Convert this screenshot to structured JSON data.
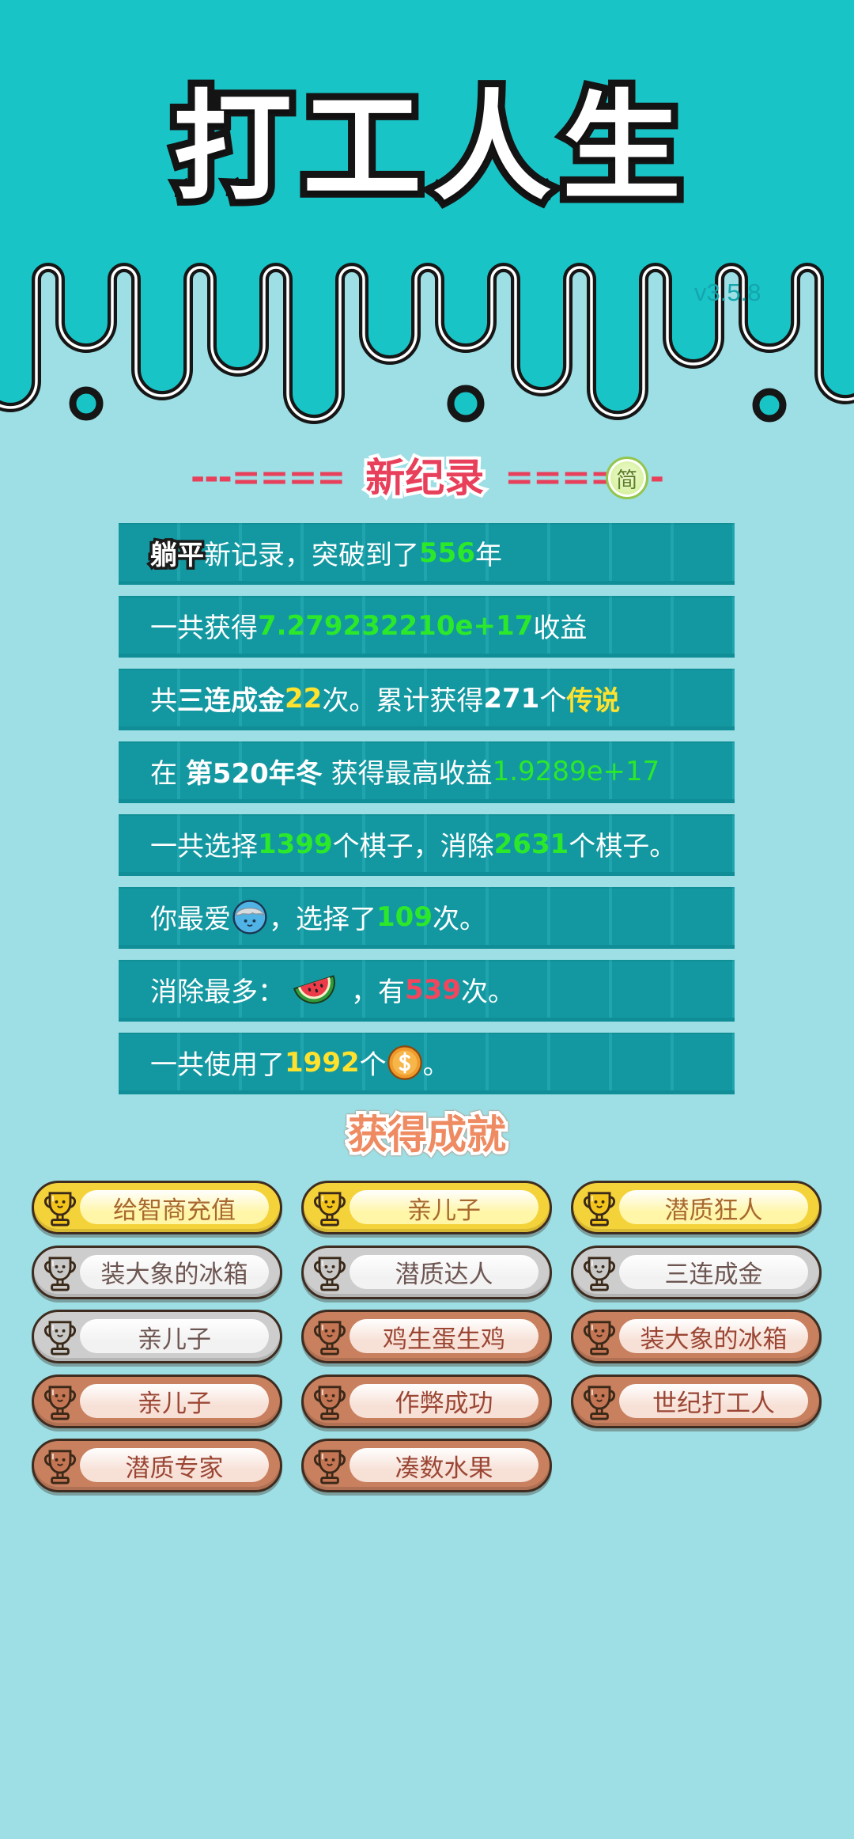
{
  "app": {
    "title": "打工人生",
    "version": "v3.5.8"
  },
  "colors": {
    "top_teal": "#19c4c7",
    "background": "#9ddfe5",
    "row": "#14a0aa",
    "highlight_green": "#2be82b",
    "highlight_yellow": "#ffe22e",
    "highlight_red": "#f2465e",
    "header_pink": "#e8405b",
    "achievement_title": "#ef8b62"
  },
  "records": {
    "header": {
      "left_deco": "---====",
      "title": "新纪录",
      "right_deco": "====",
      "badge": "简",
      "tail": "-"
    },
    "rows": [
      [
        "躺平",
        "新记录，突破到了",
        "556",
        "年"
      ],
      [
        "一共获得",
        "7.279232210e+17",
        "收益"
      ],
      [
        "共",
        "三连成金",
        "22",
        "次。累计获得",
        "271",
        "个",
        "传说"
      ],
      [
        "在 ",
        "第520年冬",
        " 获得最高收益",
        "1.9289e+17"
      ],
      [
        "一共选择",
        "1399",
        "个棋子，消除",
        "2631",
        "个棋子。"
      ],
      [
        "你最爱",
        "，选择了",
        "109",
        "次。"
      ],
      [
        "消除最多：",
        "，有",
        "539",
        "次。"
      ],
      [
        "一共使用了",
        "1992",
        "个",
        "。"
      ]
    ],
    "icons": {
      "favorite_piece": "blue-ball-face-icon",
      "most_eliminated": "watermelon-icon",
      "currency": "coin-icon"
    }
  },
  "achievements": {
    "title": "获得成就",
    "items": [
      {
        "label": "给智商充值",
        "icon": "trophy-gold-icon"
      },
      {
        "label": "亲儿子",
        "icon": "trophy-gold-icon"
      },
      {
        "label": "潜质狂人",
        "icon": "trophy-gold-icon"
      },
      {
        "label": "装大象的冰箱",
        "icon": "trophy-silver-icon"
      },
      {
        "label": "潜质达人",
        "icon": "trophy-silver-icon"
      },
      {
        "label": "三连成金",
        "icon": "trophy-silver-icon"
      },
      {
        "label": "亲儿子",
        "icon": "trophy-silver-icon"
      },
      {
        "label": "鸡生蛋生鸡",
        "icon": "trophy-bronze-icon"
      },
      {
        "label": "装大象的冰箱",
        "icon": "trophy-bronze-icon"
      },
      {
        "label": "亲儿子",
        "icon": "trophy-bronze-icon"
      },
      {
        "label": "作弊成功",
        "icon": "trophy-bronze-icon"
      },
      {
        "label": "世纪打工人",
        "icon": "trophy-bronze-icon"
      },
      {
        "label": "潜质专家",
        "icon": "trophy-bronze-icon"
      },
      {
        "label": "凑数水果",
        "icon": "trophy-bronze-icon"
      }
    ]
  }
}
